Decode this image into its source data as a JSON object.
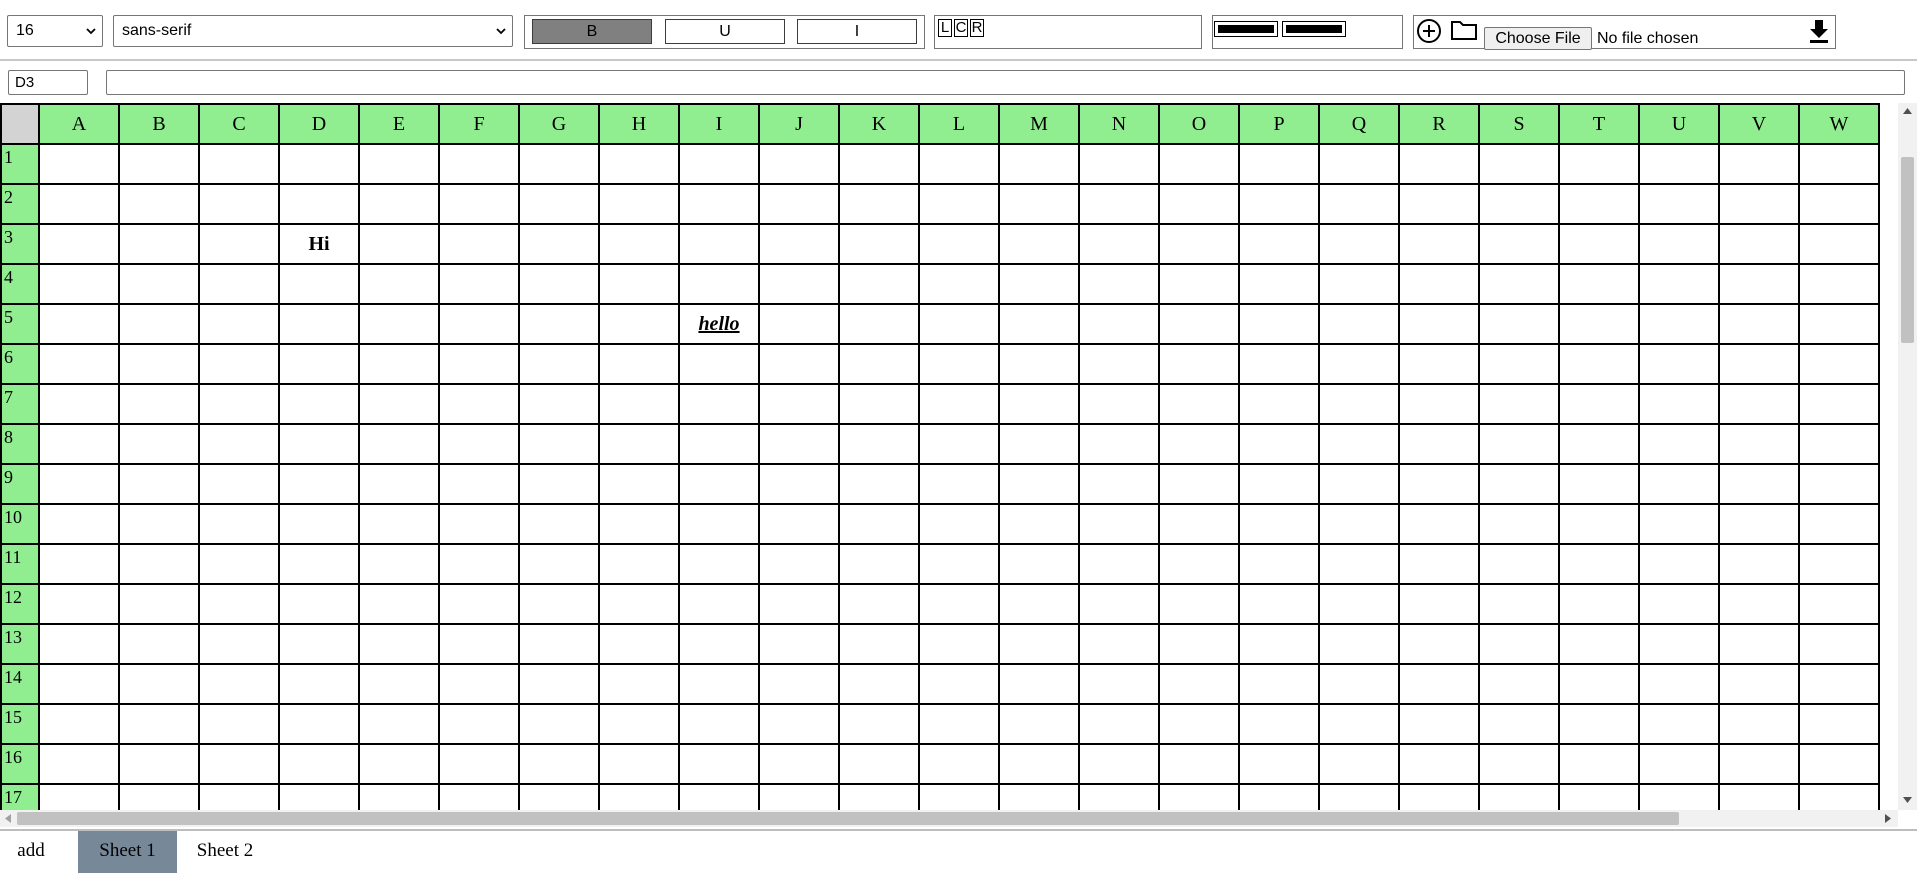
{
  "toolbar": {
    "font_size": "16",
    "font_family": "sans-serif",
    "style_buttons": {
      "bold": "B",
      "underline": "U",
      "italic": "I"
    },
    "active_style": "bold",
    "align_buttons": {
      "left": "L",
      "center": "C",
      "right": "R"
    },
    "file_input": {
      "button": "Choose File",
      "status": "No file chosen"
    },
    "icons": [
      "add-circle-icon",
      "folder-icon",
      "download-icon"
    ]
  },
  "formula_bar": {
    "cell_ref": "D3",
    "formula": ""
  },
  "sheet": {
    "columns": [
      "A",
      "B",
      "C",
      "D",
      "E",
      "F",
      "G",
      "H",
      "I",
      "J",
      "K",
      "L",
      "M",
      "N",
      "O",
      "P",
      "Q",
      "R",
      "S",
      "T",
      "U",
      "V",
      "W"
    ],
    "rows": [
      "1",
      "2",
      "3",
      "4",
      "5",
      "6",
      "7",
      "8",
      "9",
      "10",
      "11",
      "12",
      "13",
      "14",
      "15",
      "16",
      "17"
    ],
    "cells": [
      {
        "ref": "D3",
        "value": "Hi",
        "style": "bold"
      },
      {
        "ref": "I5",
        "value": "hello",
        "style": "bold italic underline"
      }
    ]
  },
  "tabs": {
    "add_label": "add",
    "sheets": [
      "Sheet 1",
      "Sheet 2"
    ],
    "active": "Sheet 1"
  },
  "colors": {
    "header_bg": "#90ee90",
    "corner_bg": "#d3d3d3",
    "active_tab": "#778899",
    "active_style_button": "#808080"
  }
}
